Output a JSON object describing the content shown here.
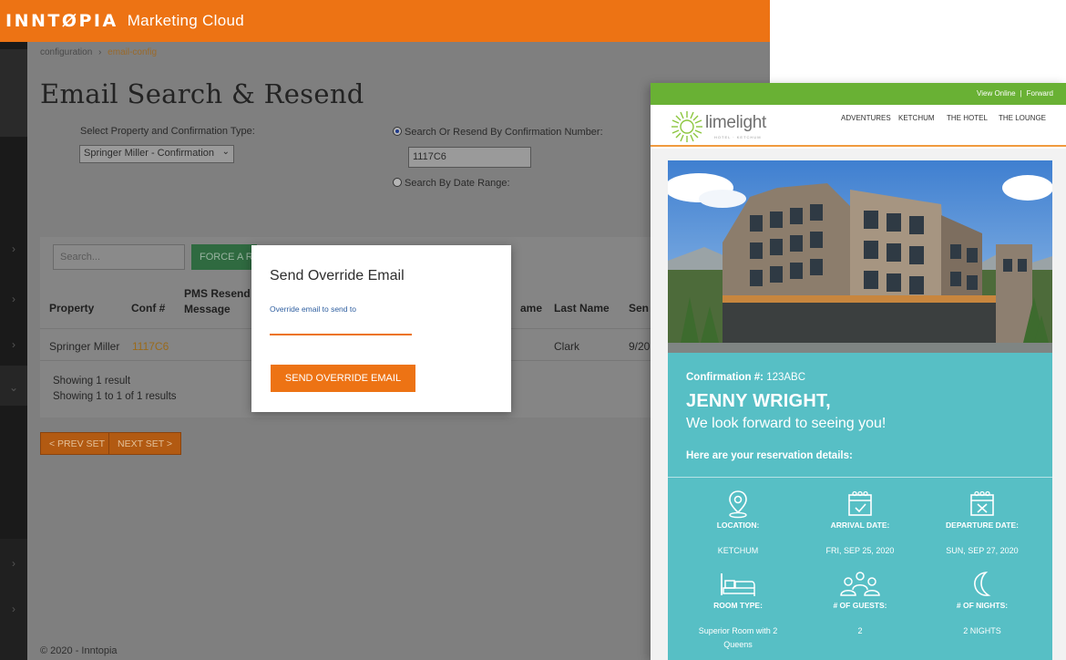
{
  "app": {
    "brand": "INNTØPIA",
    "brand_sub": "Marketing Cloud",
    "breadcrumb": {
      "item1": "configuration",
      "sep": "›",
      "item2": "email-config"
    },
    "page_title": "Email Search & Resend",
    "property_label": "Select Property and Confirmation Type:",
    "property_value": "Springer Miller - Confirmation",
    "radio_conf_label": "Search Or Resend By Confirmation Number:",
    "conf_input_value": "1117C6",
    "radio_date_label": "Search By Date Range:",
    "search_placeholder": "Search...",
    "force_button": "FORCE A RESEND",
    "table": {
      "headers": {
        "property": "Property",
        "conf": "Conf #",
        "pms": "PMS Resend Message",
        "first_name": "ame",
        "last_name": "Last Name",
        "sent": "Sen"
      },
      "row": {
        "property": "Springer Miller",
        "conf": "1117C6",
        "last_name": "Clark",
        "sent": "9/20"
      }
    },
    "footer_line1": "Showing 1 result",
    "footer_line2": "Showing 1 to 1 of 1 results",
    "prev_button": "< PREV SET",
    "next_button": "NEXT SET >",
    "copyright": "© 2020 - Inntopia"
  },
  "modal": {
    "title": "Send Override Email",
    "field_label": "Override email to send to",
    "field_value": "",
    "button": "SEND OVERRIDE EMAIL"
  },
  "email": {
    "top_links": {
      "view_online": "View Online",
      "sep": "|",
      "forward": "Forward"
    },
    "logo_text": "limelight",
    "logo_sub": "HOTEL · KETCHUM",
    "nav": [
      "ADVENTURES",
      "KETCHUM",
      "THE HOTEL",
      "THE LOUNGE"
    ],
    "confirmation_label": "Confirmation #:",
    "confirmation_number": "123ABC",
    "guest_name": "JENNY WRIGHT,",
    "greeting": "We look forward to seeing you!",
    "details_heading": "Here are your reservation details:",
    "details": [
      {
        "icon": "location-pin-icon",
        "label": "LOCATION:",
        "value": "KETCHUM"
      },
      {
        "icon": "calendar-check-icon",
        "label": "ARRIVAL DATE:",
        "value": "FRI, SEP 25, 2020"
      },
      {
        "icon": "calendar-x-icon",
        "label": "DEPARTURE DATE:",
        "value": "SUN, SEP 27, 2020"
      },
      {
        "icon": "bed-icon",
        "label": "ROOM TYPE:",
        "value": "Superior Room with 2 Queens"
      },
      {
        "icon": "guests-icon",
        "label": "# OF GUESTS:",
        "value": "2"
      },
      {
        "icon": "moon-icon",
        "label": "# OF NIGHTS:",
        "value": "2 NIGHTS"
      }
    ],
    "colors": {
      "green_bar": "#69b134",
      "teal": "#57bfc5",
      "accent_orange": "#f09a3e"
    }
  },
  "colors": {
    "brand_orange": "#ed7314",
    "sidebar": "#1a1a1a"
  }
}
